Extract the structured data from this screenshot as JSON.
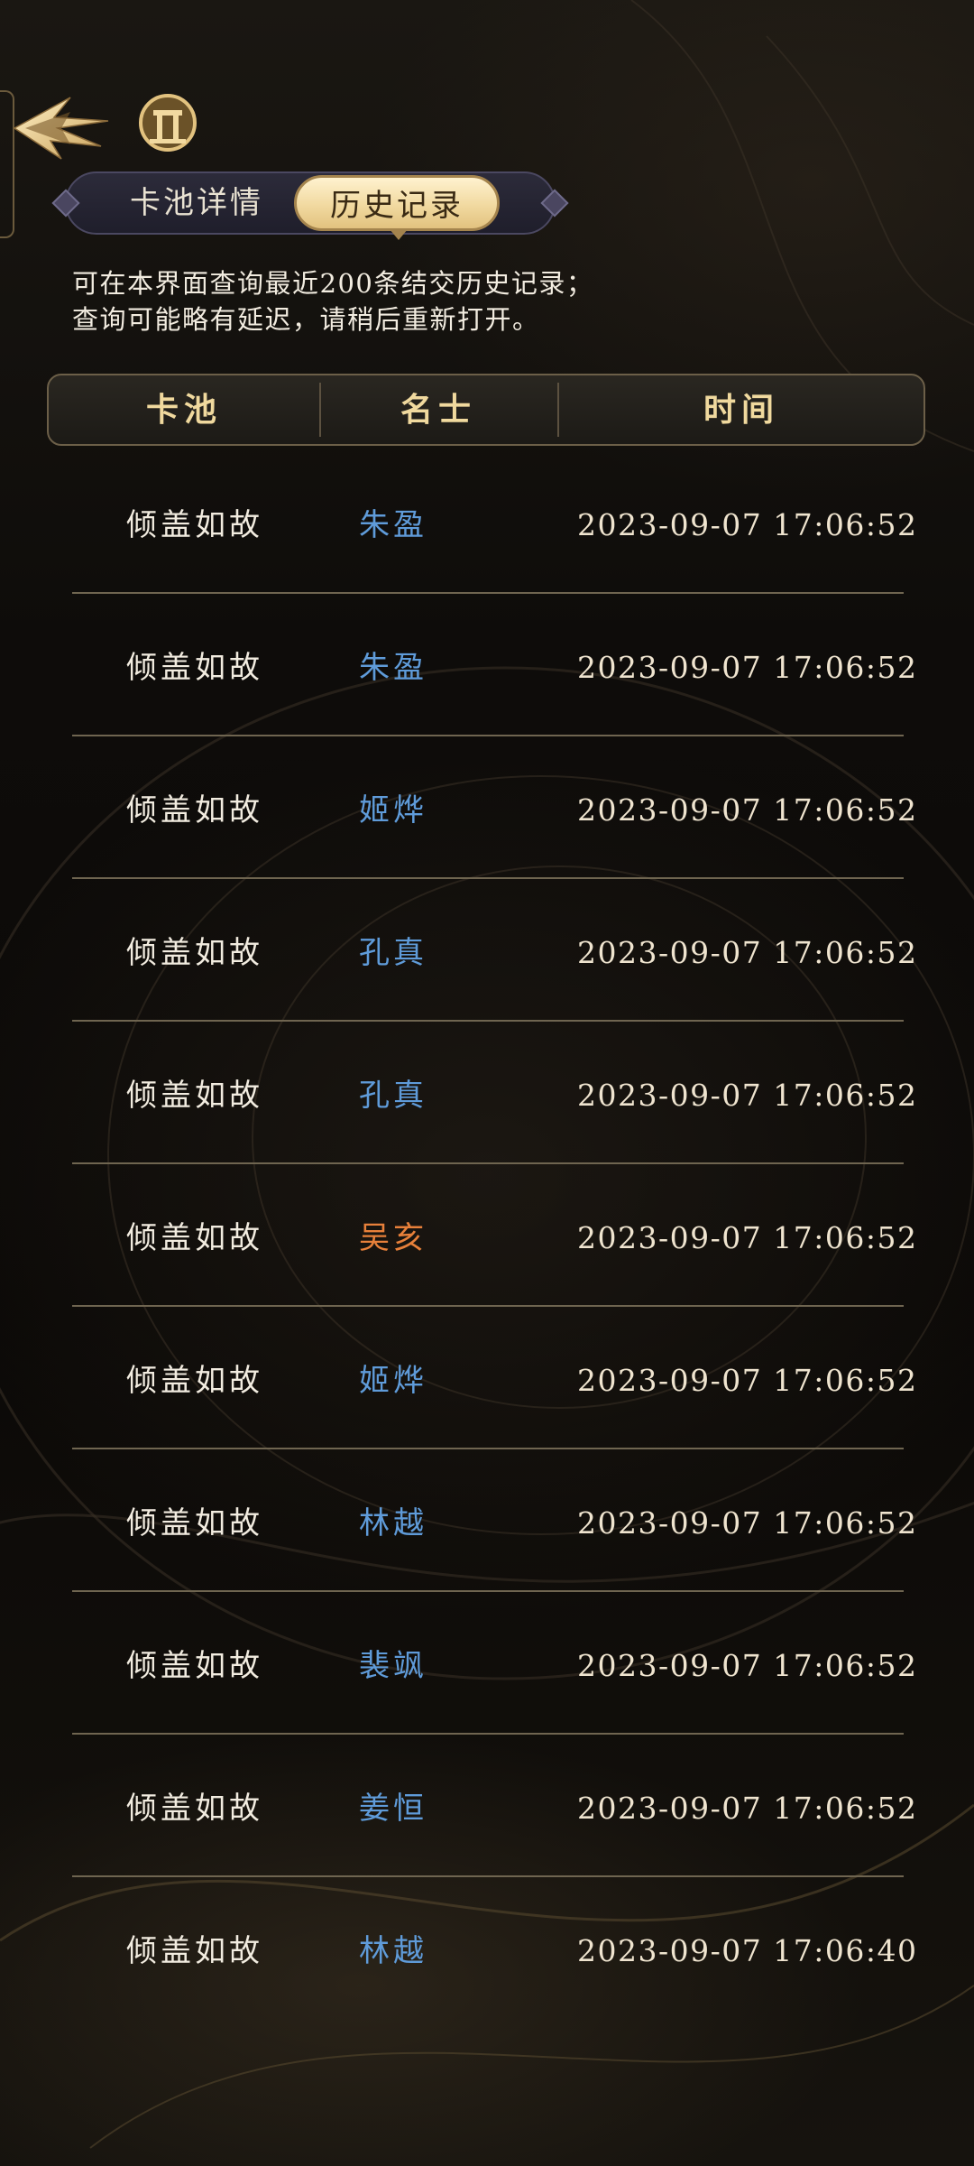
{
  "header": {
    "tabs": [
      {
        "label": "卡池详情",
        "active": false
      },
      {
        "label": "历史记录",
        "active": true
      }
    ]
  },
  "notice": {
    "line1": "可在本界面查询最近200条结交历史记录；",
    "line2": "查询可能略有延迟，请稍后重新打开。"
  },
  "table": {
    "columns": [
      "卡池",
      "名士",
      "时间"
    ],
    "rows": [
      {
        "pool": "倾盖如故",
        "hero": "朱盈",
        "time": "2023-09-07 17:06:52",
        "hero_color": "#5f9bd9"
      },
      {
        "pool": "倾盖如故",
        "hero": "朱盈",
        "time": "2023-09-07 17:06:52",
        "hero_color": "#5f9bd9"
      },
      {
        "pool": "倾盖如故",
        "hero": "姬烨",
        "time": "2023-09-07 17:06:52",
        "hero_color": "#5f9bd9"
      },
      {
        "pool": "倾盖如故",
        "hero": "孔真",
        "time": "2023-09-07 17:06:52",
        "hero_color": "#5f9bd9"
      },
      {
        "pool": "倾盖如故",
        "hero": "孔真",
        "time": "2023-09-07 17:06:52",
        "hero_color": "#5f9bd9"
      },
      {
        "pool": "倾盖如故",
        "hero": "吴亥",
        "time": "2023-09-07 17:06:52",
        "hero_color": "#e7803a"
      },
      {
        "pool": "倾盖如故",
        "hero": "姬烨",
        "time": "2023-09-07 17:06:52",
        "hero_color": "#5f9bd9"
      },
      {
        "pool": "倾盖如故",
        "hero": "林越",
        "time": "2023-09-07 17:06:52",
        "hero_color": "#5f9bd9"
      },
      {
        "pool": "倾盖如故",
        "hero": "裴飒",
        "time": "2023-09-07 17:06:52",
        "hero_color": "#5f9bd9"
      },
      {
        "pool": "倾盖如故",
        "hero": "姜恒",
        "time": "2023-09-07 17:06:52",
        "hero_color": "#5f9bd9"
      },
      {
        "pool": "倾盖如故",
        "hero": "林越",
        "time": "2023-09-07 17:06:40",
        "hero_color": "#5f9bd9"
      }
    ]
  },
  "colors": {
    "accent_gold": "#f0d99e",
    "rare_blue": "#5f9bd9",
    "epic_orange": "#e7803a"
  },
  "icons": {
    "back": "back-arrow-icon",
    "logo": "pavilion-emblem-icon"
  }
}
